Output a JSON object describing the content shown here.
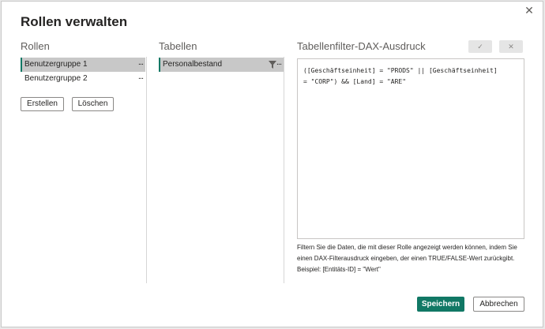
{
  "dialog": {
    "title": "Rollen verwalten",
    "close_glyph": "✕"
  },
  "roles": {
    "header": "Rollen",
    "items": [
      {
        "label": "Benutzergruppe 1",
        "more": "...",
        "selected": true
      },
      {
        "label": "Benutzergruppe 2",
        "more": "...",
        "selected": false
      }
    ],
    "create_label": "Erstellen",
    "delete_label": "Löschen"
  },
  "tables": {
    "header": "Tabellen",
    "items": [
      {
        "label": "Personalbestand",
        "more": "...",
        "icon": "filter-icon",
        "selected": true
      }
    ]
  },
  "dax": {
    "header": "Tabellenfilter-DAX-Ausdruck",
    "confirm_glyph": "✓",
    "cancel_glyph": "✕",
    "expression_lines": [
      "([Geschäftseinheit] = \"PRODS\" || [Geschäftseinheit]",
      "= \"CORP\") && [Land] = \"ARE\""
    ],
    "help_text": "Filtern Sie die Daten, die mit dieser Rolle angezeigt werden können, indem Sie einen DAX-Filterausdruck eingeben, der einen TRUE/FALSE-Wert zurückgibt. Beispiel: [Entitäts-ID] = \"Wert\""
  },
  "footer": {
    "save_label": "Speichern",
    "cancel_label": "Abbrechen"
  },
  "colors": {
    "accent": "#117865",
    "selected_bg": "#c8c8c8"
  }
}
